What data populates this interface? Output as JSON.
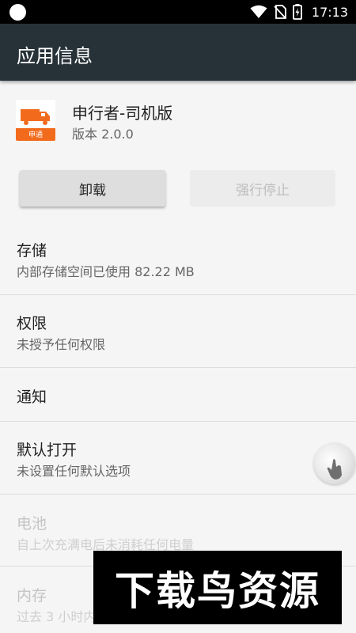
{
  "status_bar": {
    "time": "17:13",
    "icons": [
      "wifi-icon",
      "no-sim-icon",
      "battery-charging-icon"
    ]
  },
  "app_bar": {
    "title": "应用信息"
  },
  "app": {
    "name": "申行者-司机版",
    "version": "版本 2.0.0",
    "icon_text": "申通"
  },
  "buttons": {
    "uninstall": "卸载",
    "force_stop": "强行停止"
  },
  "sections": [
    {
      "title": "存储",
      "subtitle": "内部存储空间已使用 82.22 MB",
      "enabled": true
    },
    {
      "title": "权限",
      "subtitle": "未授予任何权限",
      "enabled": true
    },
    {
      "title": "通知",
      "subtitle": "",
      "enabled": true
    },
    {
      "title": "默认打开",
      "subtitle": "未设置任何默认选项",
      "enabled": true
    },
    {
      "title": "电池",
      "subtitle": "自上次充满电后未消耗任何电量",
      "enabled": false
    },
    {
      "title": "内存",
      "subtitle": "过去 3 小时内",
      "enabled": false
    }
  ],
  "watermark": {
    "text": "下载鸟资源"
  },
  "colors": {
    "app_bar": "#263238",
    "icon_orange": "#f26b1d",
    "status_bar": "#000000"
  }
}
